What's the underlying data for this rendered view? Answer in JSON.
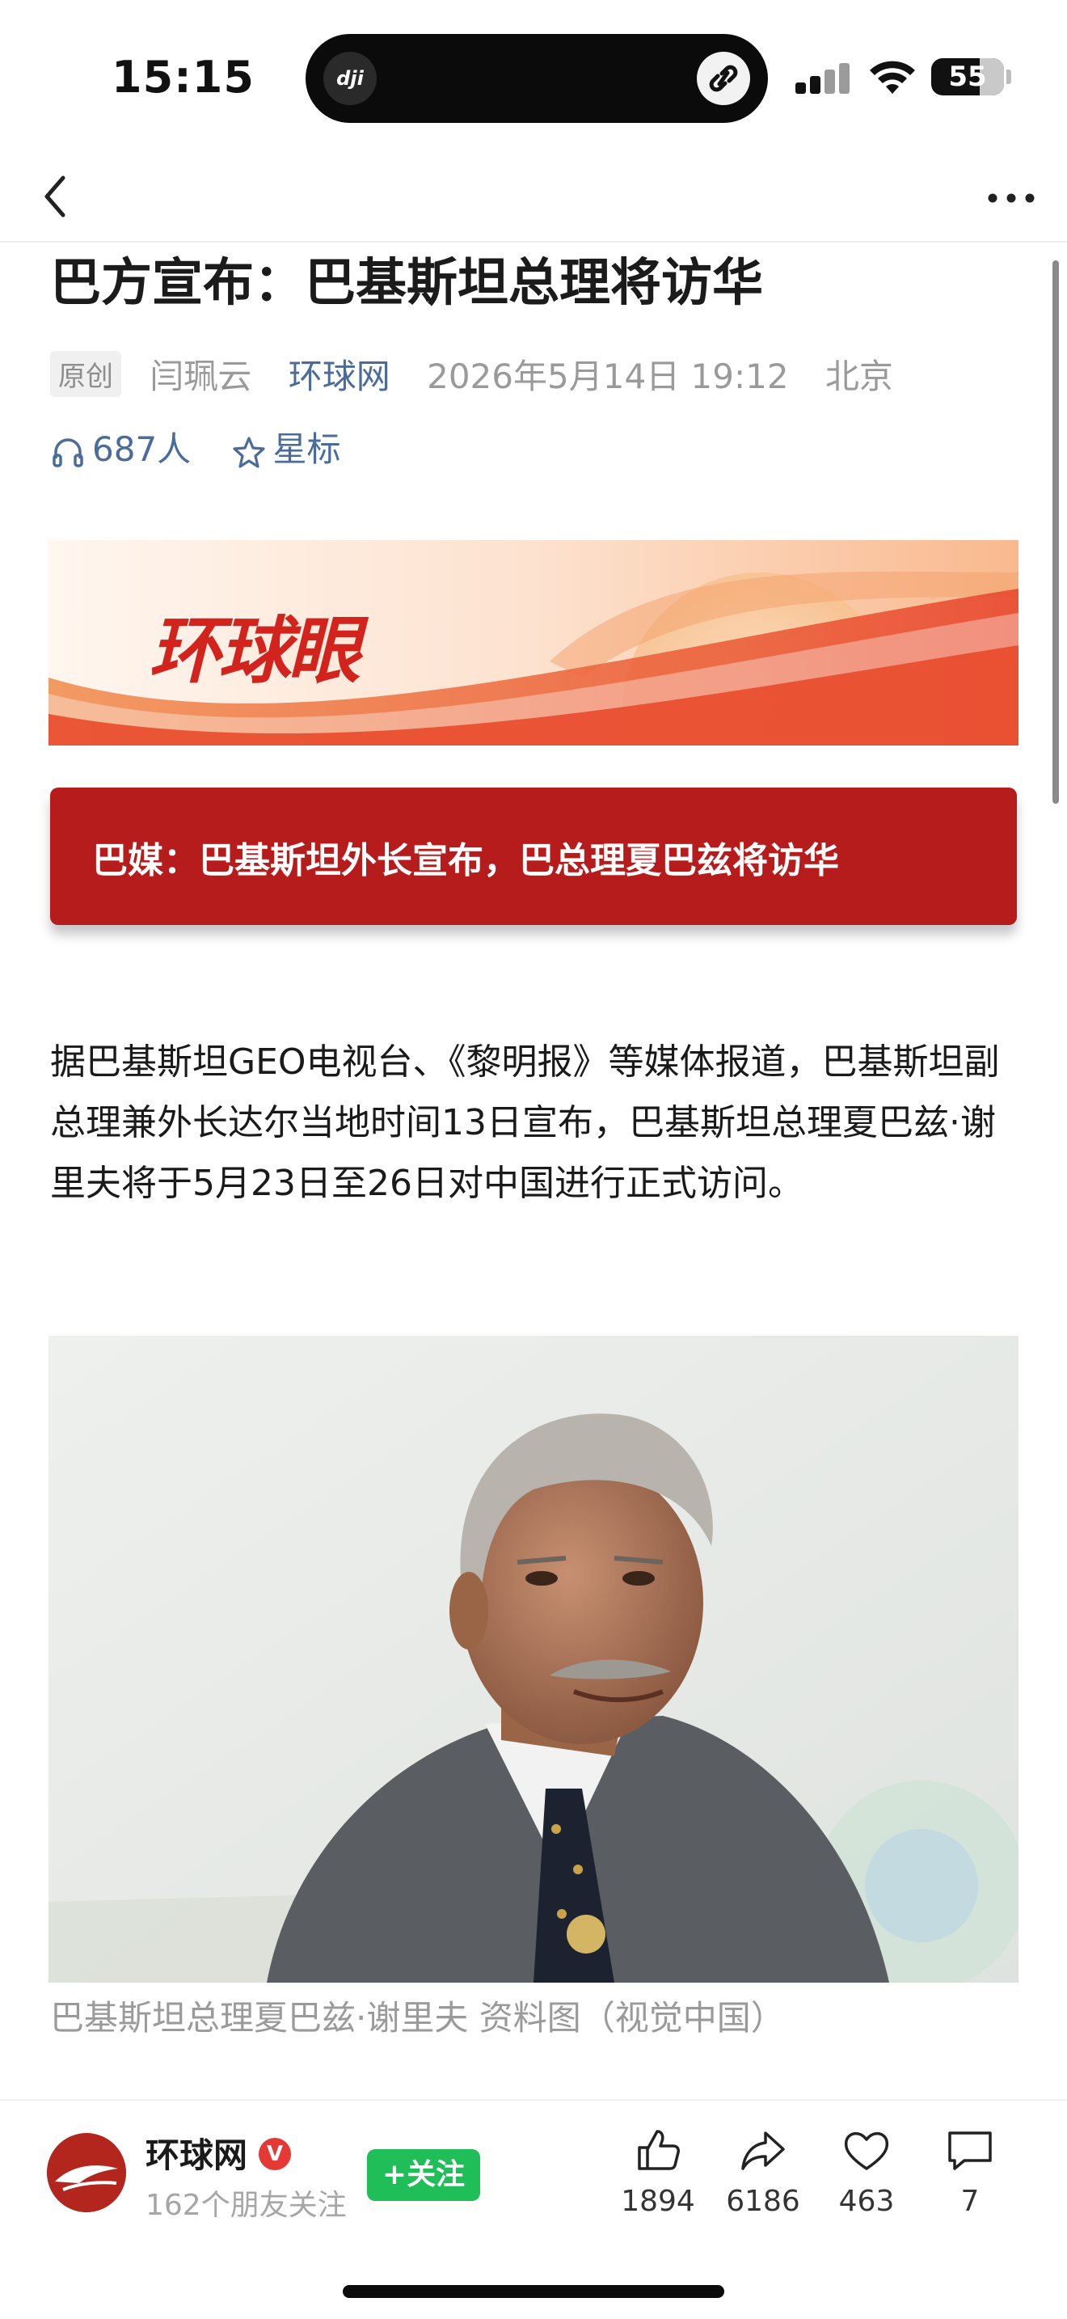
{
  "status_bar": {
    "time": "15:15",
    "battery": "55",
    "island_app": "dji"
  },
  "article": {
    "title": "巴方宣布：巴基斯坦总理将访华",
    "tag": "原创",
    "author": "闫珮云",
    "source": "环球网",
    "date": "2026年5月14日 19:12",
    "location": "北京",
    "listeners": "687人",
    "star_label": "星标",
    "banner_logo": "环球眼",
    "headline": "巴媒：巴基斯坦外长宣布，巴总理夏巴兹将访华",
    "body": "据巴基斯坦GEO电视台、《黎明报》等媒体报道，巴基斯坦副总理兼外长达尔当地时间13日宣布，巴基斯坦总理夏巴兹·谢里夫将于5月23日至26日对中国进行正式访问。",
    "caption": "巴基斯坦总理夏巴兹·谢里夫 资料图（视觉中国）"
  },
  "bottom_bar": {
    "publisher": "环球网",
    "verified_mark": "V",
    "followers": "162个朋友关注",
    "follow_label": "+关注",
    "likes": "1894",
    "shares": "6186",
    "favorites": "463",
    "comments": "7"
  },
  "colors": {
    "accent_blue": "#4a6b9b",
    "headline_red": "#b71c1c",
    "follow_green": "#1fbe58"
  }
}
